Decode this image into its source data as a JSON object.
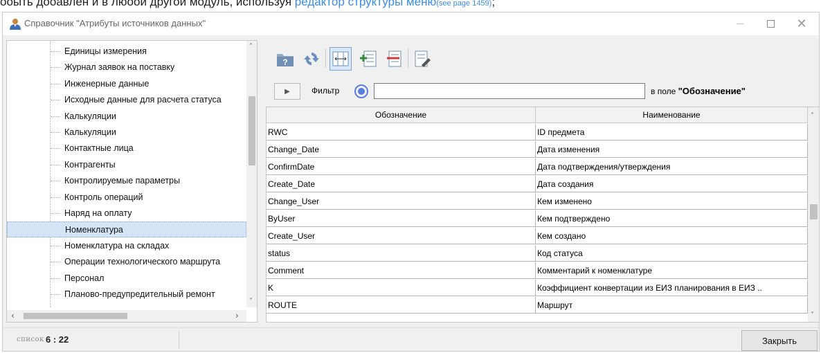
{
  "doc_fragment": {
    "text": "ооыть дооавлен и в люоои другои модуль, используя ",
    "link": "редактор структуры меню",
    "small": "(see page 1459)",
    "tail": ";"
  },
  "window": {
    "title": "Справочник \"Атрибуты источников данных\"",
    "minimize": "—",
    "maximize": "□",
    "close": "✕"
  },
  "tree": {
    "items": [
      "Единицы измерения",
      "Журнал заявок на поставку",
      "Инженерные данные",
      "Исходные данные для расчета статуса",
      "Калькуляции",
      "Калькуляции",
      "Контактные лица",
      "Контрагенты",
      "Контролируемые параметры",
      "Контроль операций",
      "Наряд на оплату",
      "Номенклатура",
      "Номенклатура на складах",
      "Операции технологического маршрута",
      "Персонал",
      "Планово-предупредительный ремонт"
    ],
    "selected_index": 11
  },
  "toolbar": {
    "icons": [
      "help-folder-icon",
      "refresh-icon",
      "fit-columns-icon",
      "add-row-icon",
      "delete-row-icon",
      "edit-row-icon"
    ]
  },
  "filter": {
    "label": "Фильтр",
    "value": "",
    "field_prefix": "в поле ",
    "field_name": "\"Обозначение\""
  },
  "grid": {
    "columns": [
      "Обозначение",
      "Наименование"
    ],
    "rows": [
      [
        "RWC",
        "ID предмета"
      ],
      [
        "Change_Date",
        "Дата изменения"
      ],
      [
        "ConfirmDate",
        "Дата подтверждения/утверждения"
      ],
      [
        "Create_Date",
        "Дата создания"
      ],
      [
        "Change_User",
        "Кем изменено"
      ],
      [
        "ByUser",
        "Кем подтверждено"
      ],
      [
        "Create_User",
        "Кем создано"
      ],
      [
        "status",
        "Код статуса"
      ],
      [
        "Comment",
        "Комментарий к номенклатуре"
      ],
      [
        "K",
        "Коэффициент конвертации из ЕИЗ планирования в ЕИЗ .."
      ],
      [
        "ROUTE",
        "Маршрут"
      ]
    ]
  },
  "status": {
    "label": "список",
    "value": "6 : 22",
    "close_button": "Закрыть"
  }
}
